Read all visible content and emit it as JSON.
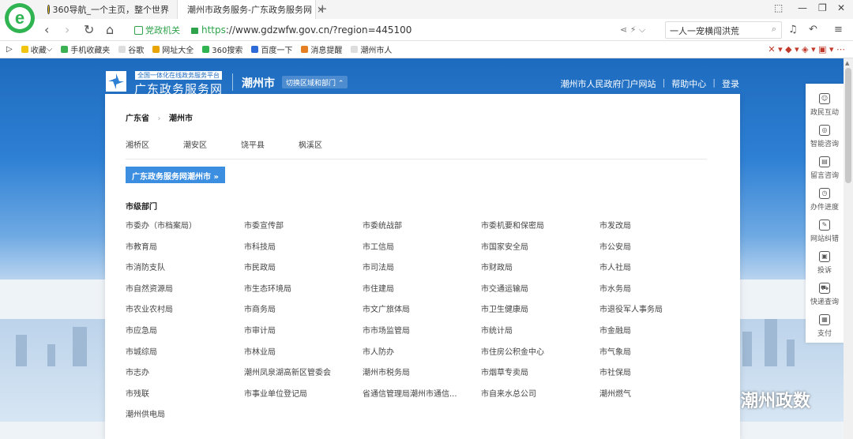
{
  "browser": {
    "tabs": [
      {
        "label": "360导航_一个主页，整个世界"
      },
      {
        "label": "潮州市政务服务-广东政务服务网"
      }
    ],
    "tab_close": "×",
    "new_tab": "+",
    "url_https": "https",
    "url_rest": "://www.gdzwfw.gov.cn/?region=445100",
    "trust_label": "党政机关",
    "search_text": "一人一宠横闯洪荒",
    "bookmarks": [
      "收藏",
      "手机收藏夹",
      "谷歌",
      "网址大全",
      "360搜索",
      "百度一下",
      "消息提醒",
      "潮州市人"
    ]
  },
  "header": {
    "slogan": "全国一体化在线政务服务平台",
    "site_name": "广东政务服务网",
    "city": "潮州市",
    "switch_label": "切换区域和部门 ⌃",
    "links": [
      "潮州市人民政府门户网站",
      "帮助中心",
      "登录"
    ]
  },
  "panel": {
    "breadcrumb": {
      "province": "广东省",
      "city": "潮州市"
    },
    "districts": [
      "湘桥区",
      "潮安区",
      "饶平县",
      "枫溪区"
    ],
    "city_button": "广东政务服务网潮州市 »",
    "dept_title": "市级部门",
    "departments": [
      "市委办（市档案局）",
      "市委宣传部",
      "市委统战部",
      "市委机要和保密局",
      "市发改局",
      "市教育局",
      "市科技局",
      "市工信局",
      "市国家安全局",
      "市公安局",
      "市消防支队",
      "市民政局",
      "市司法局",
      "市财政局",
      "市人社局",
      "市自然资源局",
      "市生态环境局",
      "市住建局",
      "市交通运输局",
      "市水务局",
      "市农业农村局",
      "市商务局",
      "市文广旅体局",
      "市卫生健康局",
      "市退役军人事务局",
      "市应急局",
      "市审计局",
      "市市场监管局",
      "市统计局",
      "市金融局",
      "市城综局",
      "市林业局",
      "市人防办",
      "市住房公积金中心",
      "市气象局",
      "市志办",
      "潮州凤泉湖高新区管委会",
      "潮州市税务局",
      "市烟草专卖局",
      "市社保局",
      "市残联",
      "市事业单位登记局",
      "省通信管理局潮州市通信...",
      "市自来水总公司",
      "潮州燃气",
      "潮州供电局"
    ]
  },
  "float_bar": [
    "政民互动",
    "智能咨询",
    "留言咨询",
    "办件进度",
    "网站纠错",
    "投诉",
    "快递查询",
    "支付"
  ],
  "watermark": "潮州政数"
}
